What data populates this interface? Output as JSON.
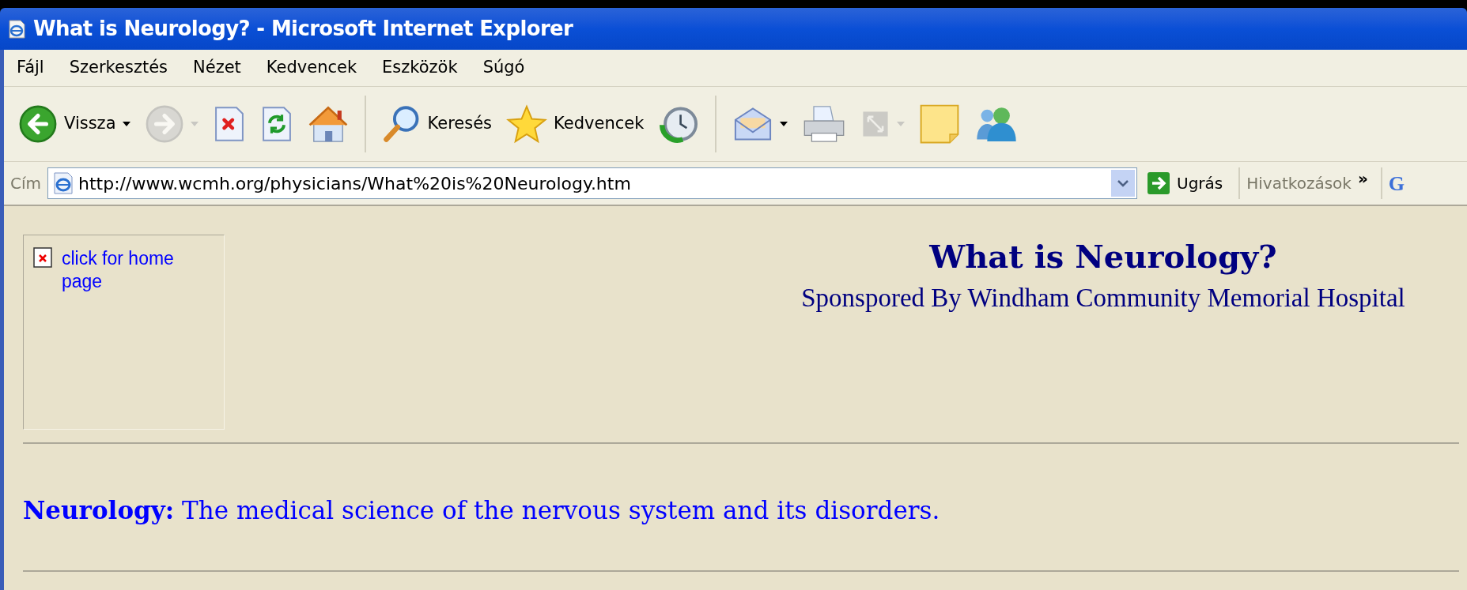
{
  "window": {
    "title": "What is Neurology? - Microsoft Internet Explorer"
  },
  "menu": [
    "Fájl",
    "Szerkesztés",
    "Nézet",
    "Kedvencek",
    "Eszközök",
    "Súgó"
  ],
  "toolbar": [
    {
      "kind": "back",
      "label": "Vissza",
      "dropdown": true,
      "disabled": false
    },
    {
      "kind": "forward",
      "dropdown": true,
      "disabled": true
    },
    {
      "kind": "stop",
      "dropdown": false,
      "disabled": false
    },
    {
      "kind": "refresh",
      "dropdown": false,
      "disabled": false
    },
    {
      "kind": "home",
      "dropdown": false,
      "disabled": false
    },
    {
      "kind": "separator"
    },
    {
      "kind": "search",
      "label": "Keresés",
      "dropdown": false,
      "disabled": false
    },
    {
      "kind": "favorites",
      "label": "Kedvencek",
      "dropdown": false,
      "disabled": false
    },
    {
      "kind": "history",
      "dropdown": false,
      "disabled": false
    },
    {
      "kind": "separator"
    },
    {
      "kind": "mail",
      "dropdown": true,
      "disabled": false
    },
    {
      "kind": "print",
      "dropdown": false,
      "disabled": false
    },
    {
      "kind": "fullscreen",
      "dropdown": true,
      "disabled": true
    },
    {
      "kind": "notes",
      "dropdown": false,
      "disabled": false
    },
    {
      "kind": "messenger",
      "dropdown": false,
      "disabled": false
    }
  ],
  "address_bar": {
    "label": "Cím",
    "url": "http://www.wcmh.org/physicians/What%20is%20Neurology.htm",
    "go_label": "Ugrás",
    "links_label": "Hivatkozások",
    "more": "»",
    "search_logo": "G"
  },
  "page": {
    "home_link": "click for home page",
    "heading": "What is Neurology?",
    "subtitle": "Sponspored By Windham Community Memorial Hospital",
    "definition": "**Neurology:** The medical science of the nervous system and its disorders."
  }
}
